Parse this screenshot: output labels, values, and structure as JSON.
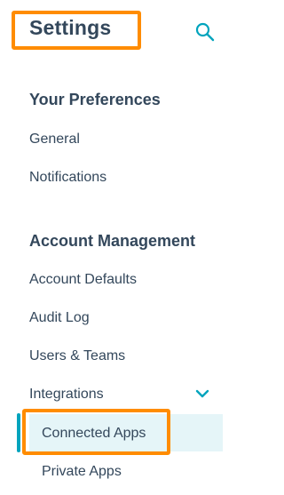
{
  "header": {
    "title": "Settings",
    "search_icon": "search-icon"
  },
  "sections": [
    {
      "heading": "Your Preferences",
      "items": [
        "General",
        "Notifications"
      ]
    },
    {
      "heading": "Account Management",
      "items": [
        "Account Defaults",
        "Audit Log",
        "Users & Teams",
        "Integrations"
      ]
    }
  ],
  "integrations": {
    "expanded_icon": "chevron-down-icon",
    "sub_items": [
      "Connected Apps",
      "Private Apps"
    ],
    "active": "Connected Apps"
  },
  "colors": {
    "accent": "#00a4bd",
    "active_bg": "#e5f5f8",
    "highlight": "#ff8c00",
    "text": "#33475b"
  }
}
